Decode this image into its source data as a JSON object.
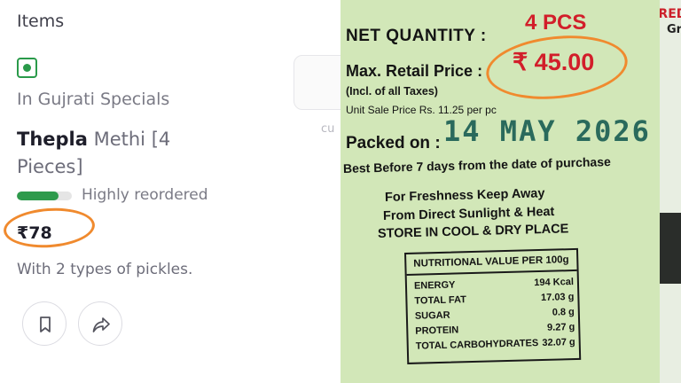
{
  "app": {
    "section_title": "Items",
    "category": "In Gujrati Specials",
    "item_name_bold": "Thepla",
    "item_name_rest": " Methi [4 Pieces]",
    "reorder_level": 0.75,
    "reorder_text": "Highly reordered",
    "price": "₹78",
    "description": "With 2 types of pickles.",
    "ghost_text": "cu",
    "icons": [
      "veg-icon",
      "bookmark-icon",
      "share-icon"
    ],
    "accent_color": "#2e9a4c",
    "annotation_color": "#f08a2e"
  },
  "photo": {
    "ingredients_heading": "INGRED",
    "ingredients_fragment": "Gr",
    "net_quantity_label": "NET QUANTITY :",
    "net_quantity_value": "4 PCS",
    "mrp_label": "Max. Retail Price :",
    "mrp_value": "₹ 45.00",
    "incl_taxes": "(Incl. of all Taxes)",
    "unit_price": "Unit Sale Price Rs. 11.25 per pc",
    "packed_label": "Packed on :",
    "packed_value": "14 MAY 2026",
    "best_before": "Best Before 7 days from the date of purchase",
    "freshness_1": "For Freshness Keep Away",
    "freshness_2": "From Direct Sunlight & Heat",
    "freshness_3": "STORE IN COOL & DRY PLACE",
    "nutrition": {
      "heading": "NUTRITIONAL VALUE PER 100g",
      "rows": [
        {
          "name": "ENERGY",
          "value": "194 Kcal"
        },
        {
          "name": "TOTAL FAT",
          "value": "17.03 g"
        },
        {
          "name": "SUGAR",
          "value": "0.8 g"
        },
        {
          "name": "PROTEIN",
          "value": "9.27 g"
        },
        {
          "name": "TOTAL CARBOHYDRATES",
          "value": "32.07 g"
        }
      ]
    },
    "label_color": "#d2e7b8",
    "price_color": "#d21e2a"
  }
}
